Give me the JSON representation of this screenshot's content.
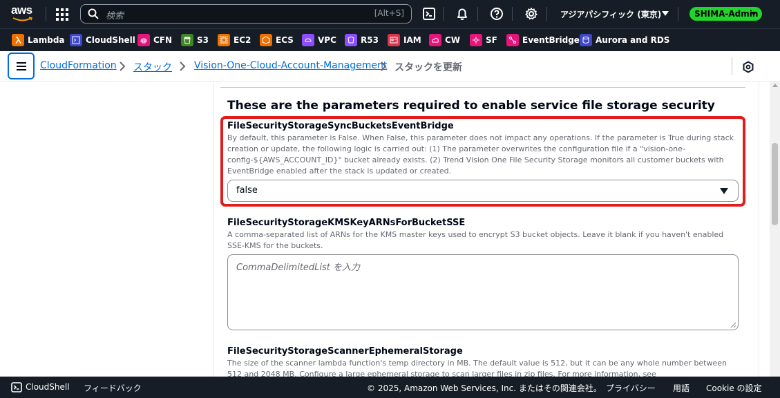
{
  "topnav": {
    "logo": "aws",
    "search_placeholder": "検索",
    "search_shortcut": "[Alt+S]",
    "icons": [
      "grid-icon",
      "search-icon",
      "cloudshell-icon",
      "bell-icon",
      "help-icon",
      "gear-icon"
    ],
    "region": "アジアパシフィック (東京)",
    "account": "SHIMA-Admin",
    "account_color": "#22d42c"
  },
  "favorites": [
    {
      "label": "Lambda",
      "color": "#ed7100",
      "icon": "lambda-icon"
    },
    {
      "label": "CloudShell",
      "color": "#3f48cc",
      "icon": "cloudshell-icon"
    },
    {
      "label": "CFN",
      "color": "#e7157b",
      "icon": "cloudformation-icon"
    },
    {
      "label": "S3",
      "color": "#3f8624",
      "icon": "s3-icon"
    },
    {
      "label": "EC2",
      "color": "#ed7100",
      "icon": "ec2-icon"
    },
    {
      "label": "ECS",
      "color": "#ed7100",
      "icon": "ecs-icon"
    },
    {
      "label": "VPC",
      "color": "#8c4fff",
      "icon": "vpc-icon"
    },
    {
      "label": "R53",
      "color": "#8c4fff",
      "icon": "route53-icon"
    },
    {
      "label": "IAM",
      "color": "#dd344c",
      "icon": "iam-icon"
    },
    {
      "label": "CW",
      "color": "#e7157b",
      "icon": "cloudwatch-icon"
    },
    {
      "label": "SF",
      "color": "#e7157b",
      "icon": "stepfunctions-icon"
    },
    {
      "label": "EventBridge",
      "color": "#e7157b",
      "icon": "eventbridge-icon"
    },
    {
      "label": "Aurora and RDS",
      "color": "#3f48cc",
      "icon": "rds-icon"
    }
  ],
  "breadcrumb": {
    "items": [
      "CloudFormation",
      "スタック",
      "Vision-One-Cloud-Account-Management"
    ],
    "current": "スタックを更新"
  },
  "main": {
    "section_title": "These are the parameters required to enable service file storage security",
    "params": [
      {
        "name": "FileSecurityStorageSyncBucketsEventBridge",
        "description": "By default, this parameter is False. When False, this parameter does not impact any operations. If the parameter is True during stack creation or update, the following logic is carried out: (1) The parameter overwrites the configuration file if a \"vision-one-config-${AWS_ACCOUNT_ID}\" bucket already exists. (2) Trend Vision One File Security Storage monitors all customer buckets with EventBridge enabled after the stack is updated or created.",
        "value": "false"
      },
      {
        "name": "FileSecurityStorageKMSKeyARNsForBucketSSE",
        "description": "A comma-separated list of ARNs for the KMS master keys used to encrypt S3 bucket objects. Leave it blank if you haven't enabled SSE-KMS for the buckets.",
        "placeholder": "CommaDelimitedList を入力"
      },
      {
        "name": "FileSecurityStorageScannerEphemeralStorage",
        "description": "The size of the scanner lambda function's temp directory in MB. The default value is 512, but it can be any whole number between 512 and 2048 MB. Configure a large ephemeral storage to scan larger files in zip files. For more information, see"
      }
    ],
    "highlight_color": "#e21b1b"
  },
  "footer": {
    "cloudshell": "CloudShell",
    "feedback": "フィードバック",
    "copyright": "© 2025, Amazon Web Services, Inc. またはその関連会社。",
    "privacy": "プライバシー",
    "terms": "用語",
    "cookie": "Cookie の設定"
  }
}
